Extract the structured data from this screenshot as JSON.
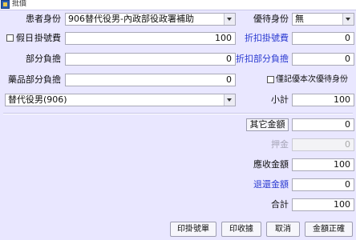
{
  "window": {
    "title": "批價"
  },
  "left": {
    "patient_type_label": "患者身份",
    "patient_type_value": "906替代役男-內政部役政署補助",
    "holiday_label": "假日",
    "reg_fee_label": "掛號費",
    "reg_fee_value": "100",
    "copay_label": "部分負擔",
    "copay_value": "0",
    "drug_copay_label": "藥品部分負擔",
    "drug_copay_value": "0",
    "subsidy_value": "替代役男(906)"
  },
  "right": {
    "discount_type_label": "優待身份",
    "discount_type_value": "無",
    "reg_discount_label": "折扣掛號費",
    "reg_discount_value": "0",
    "copay_discount_label": "折扣部分負擔",
    "copay_discount_value": "0",
    "once_only_label": "僅記優本次優待身份",
    "subtotal_label": "小計",
    "subtotal_value": "100"
  },
  "totals": {
    "other_amount_label": "其它金額",
    "other_amount_value": "0",
    "deposit_label": "押金",
    "deposit_value": "0",
    "receivable_label": "應收金額",
    "receivable_value": "100",
    "refund_label": "退還金額",
    "refund_value": "0",
    "total_label": "合計",
    "total_value": "100"
  },
  "buttons": {
    "print_reg": "印掛號單",
    "print_receipt": "印收據",
    "cancel": "取消",
    "confirm": "金額正確"
  },
  "colors": {
    "panel_bg": "#e9e7ff",
    "blue_label": "#2b3bd1",
    "disabled_label": "#a7a6b8"
  }
}
